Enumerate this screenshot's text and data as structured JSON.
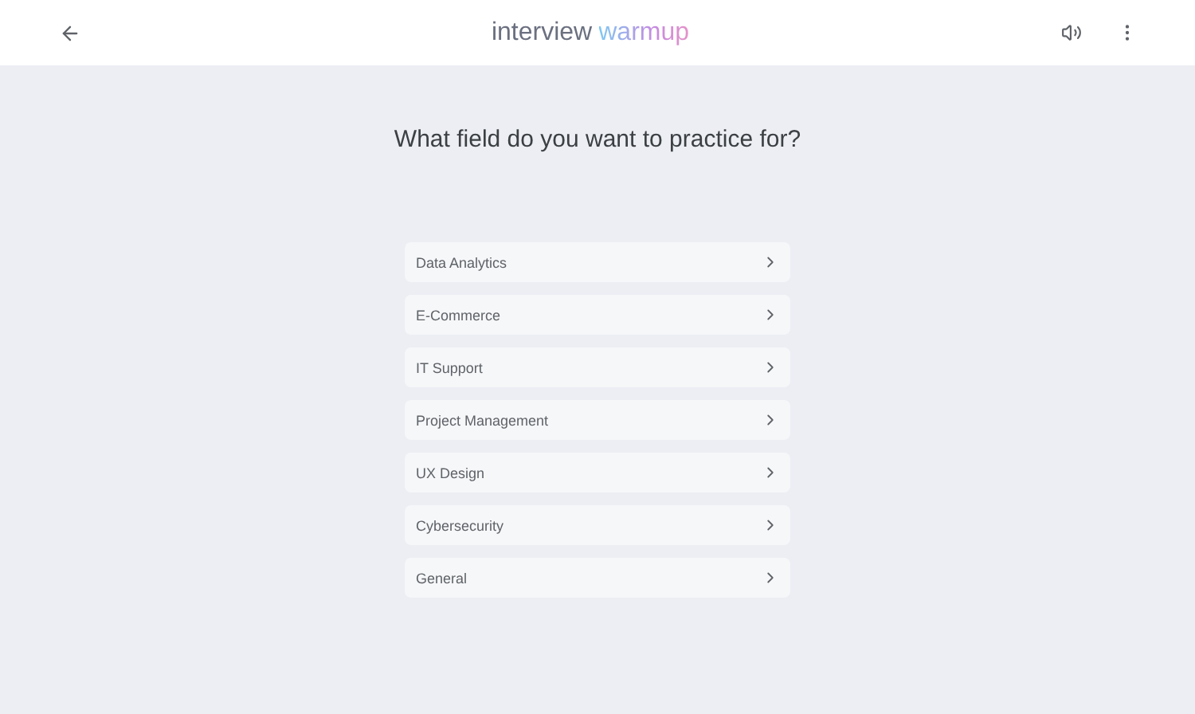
{
  "header": {
    "logo": {
      "word": "interview",
      "accent": "warmup"
    }
  },
  "question": "What field do you want to practice for?",
  "fields": [
    {
      "label": "Data Analytics"
    },
    {
      "label": "E-Commerce"
    },
    {
      "label": "IT Support"
    },
    {
      "label": "Project Management"
    },
    {
      "label": "UX Design"
    },
    {
      "label": "Cybersecurity"
    },
    {
      "label": "General"
    }
  ]
}
